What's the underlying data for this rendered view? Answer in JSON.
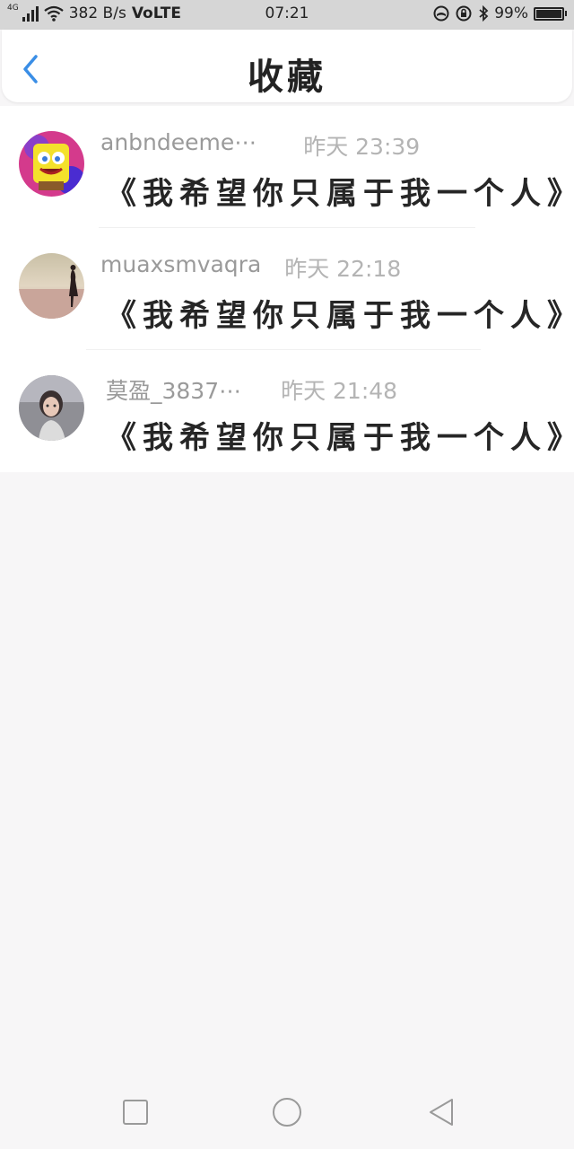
{
  "status_bar": {
    "network_type": "4G",
    "speed": "382 B/s",
    "volte": "VoLTE",
    "time": "07:21",
    "battery": "99%",
    "battery_level": 0.99,
    "icons": [
      "signal-icon",
      "wifi-icon",
      "nfc-icon",
      "lock-rotation-icon",
      "bluetooth-icon",
      "battery-icon"
    ]
  },
  "header": {
    "title": "收藏",
    "back_icon": "back-chevron-icon",
    "accent_color": "#3a8ee6"
  },
  "favorites": [
    {
      "username": "anbndeeme⋯",
      "time": "昨天 23:39",
      "quote": "《我希望你只属于我一个人》",
      "avatar": "spongebob-avatar"
    },
    {
      "username": "muaxsmvaqra",
      "time": "昨天 22:18",
      "quote": "《我希望你只属于我一个人》",
      "avatar": "beach-silhouette-avatar"
    },
    {
      "username": "莫盈_3837⋯",
      "time": "昨天 21:48",
      "quote": "《我希望你只属于我一个人》",
      "avatar": "girl-photo-avatar"
    }
  ],
  "nav_bar": {
    "icons": [
      "recent-apps-icon",
      "home-icon",
      "back-icon"
    ]
  }
}
